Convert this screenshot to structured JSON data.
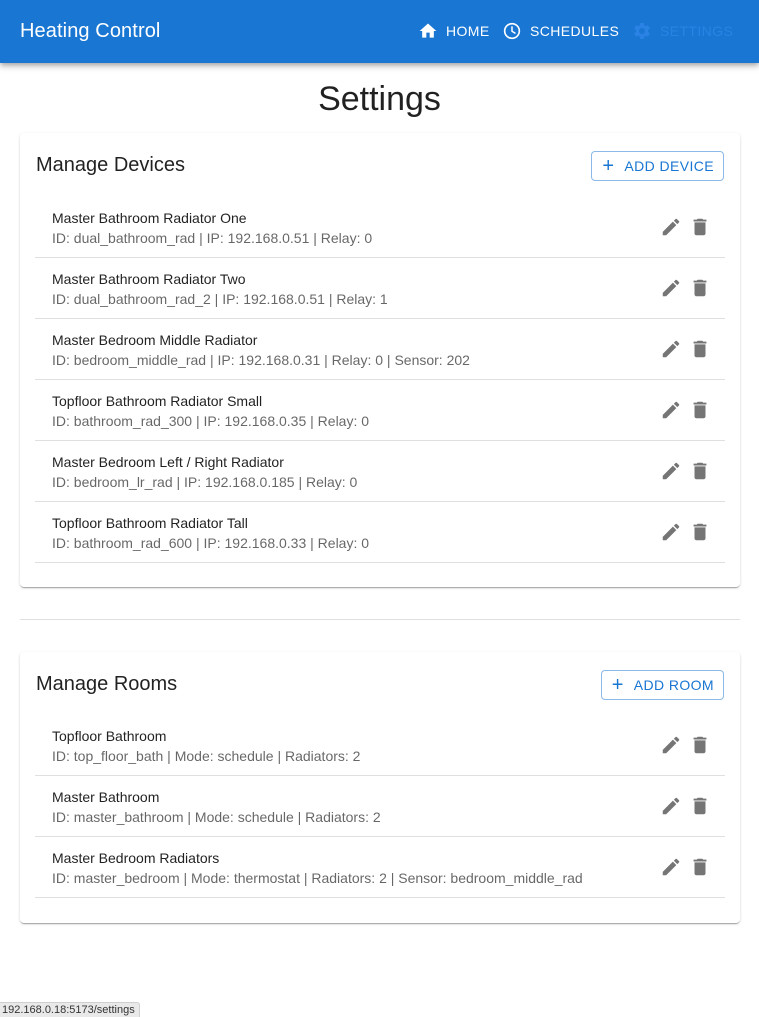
{
  "app": {
    "title": "Heating Control"
  },
  "nav": {
    "home": "HOME",
    "schedules": "SCHEDULES",
    "settings": "SETTINGS"
  },
  "page": {
    "title": "Settings"
  },
  "devices": {
    "title": "Manage Devices",
    "add_label": "ADD DEVICE",
    "items": [
      {
        "name": "Master Bathroom Radiator One",
        "details": "ID: dual_bathroom_rad | IP: 192.168.0.51 | Relay: 0"
      },
      {
        "name": "Master Bathroom Radiator Two",
        "details": "ID: dual_bathroom_rad_2 | IP: 192.168.0.51 | Relay: 1"
      },
      {
        "name": "Master Bedroom Middle Radiator",
        "details": "ID: bedroom_middle_rad | IP: 192.168.0.31 | Relay: 0 | Sensor: 202"
      },
      {
        "name": "Topfloor Bathroom Radiator Small",
        "details": "ID: bathroom_rad_300 | IP: 192.168.0.35 | Relay: 0"
      },
      {
        "name": "Master Bedroom Left / Right Radiator",
        "details": "ID: bedroom_lr_rad | IP: 192.168.0.185 | Relay: 0"
      },
      {
        "name": "Topfloor Bathroom Radiator Tall",
        "details": "ID: bathroom_rad_600 | IP: 192.168.0.33 | Relay: 0"
      }
    ]
  },
  "rooms": {
    "title": "Manage Rooms",
    "add_label": "ADD ROOM",
    "items": [
      {
        "name": "Topfloor Bathroom",
        "details": "ID: top_floor_bath | Mode: schedule | Radiators: 2"
      },
      {
        "name": "Master Bathroom",
        "details": "ID: master_bathroom | Mode: schedule | Radiators: 2"
      },
      {
        "name": "Master Bedroom Radiators",
        "details": "ID: master_bedroom | Mode: thermostat | Radiators: 2 | Sensor: bedroom_middle_rad"
      }
    ]
  },
  "status_bar": {
    "url": "192.168.0.18:5173/settings"
  },
  "icons": {
    "home": "home-icon",
    "schedules": "clock-icon",
    "settings": "gear-icon",
    "add": "plus-icon",
    "edit": "pencil-icon",
    "delete": "trash-icon"
  },
  "colors": {
    "primary": "#1976d2",
    "active_nav": "#2a83e4",
    "icon_gray": "#757575"
  }
}
